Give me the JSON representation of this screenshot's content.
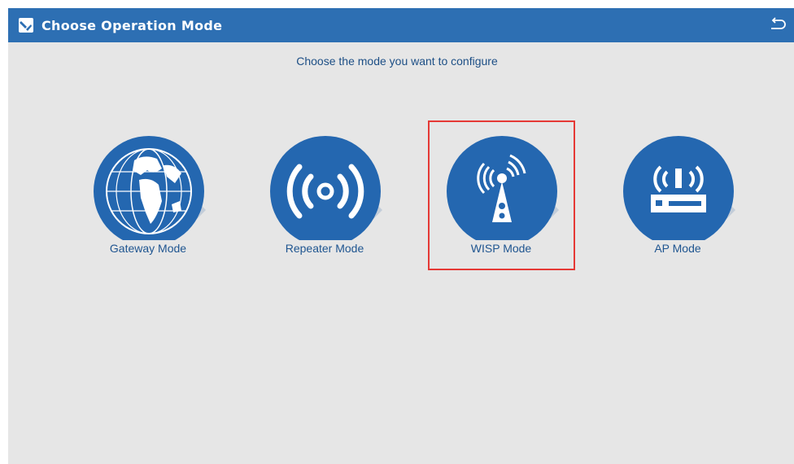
{
  "header": {
    "title": "Choose Operation Mode",
    "app_icon": "router-config-icon",
    "back_icon": "back-arrow-icon"
  },
  "subtitle": "Choose the mode you want to configure",
  "modes": [
    {
      "label": "Gateway Mode",
      "icon": "globe-icon",
      "selected": false
    },
    {
      "label": "Repeater Mode",
      "icon": "wireless-signal-icon",
      "selected": false
    },
    {
      "label": "WISP Mode",
      "icon": "antenna-tower-icon",
      "selected": true
    },
    {
      "label": "AP Mode",
      "icon": "access-point-icon",
      "selected": false
    }
  ],
  "colors": {
    "header": "#2d6fb3",
    "background": "#e6e6e6",
    "circle": "#2467b0",
    "shadow": "#bcc8d6",
    "label": "#1f5590",
    "selection": "#e53935"
  }
}
